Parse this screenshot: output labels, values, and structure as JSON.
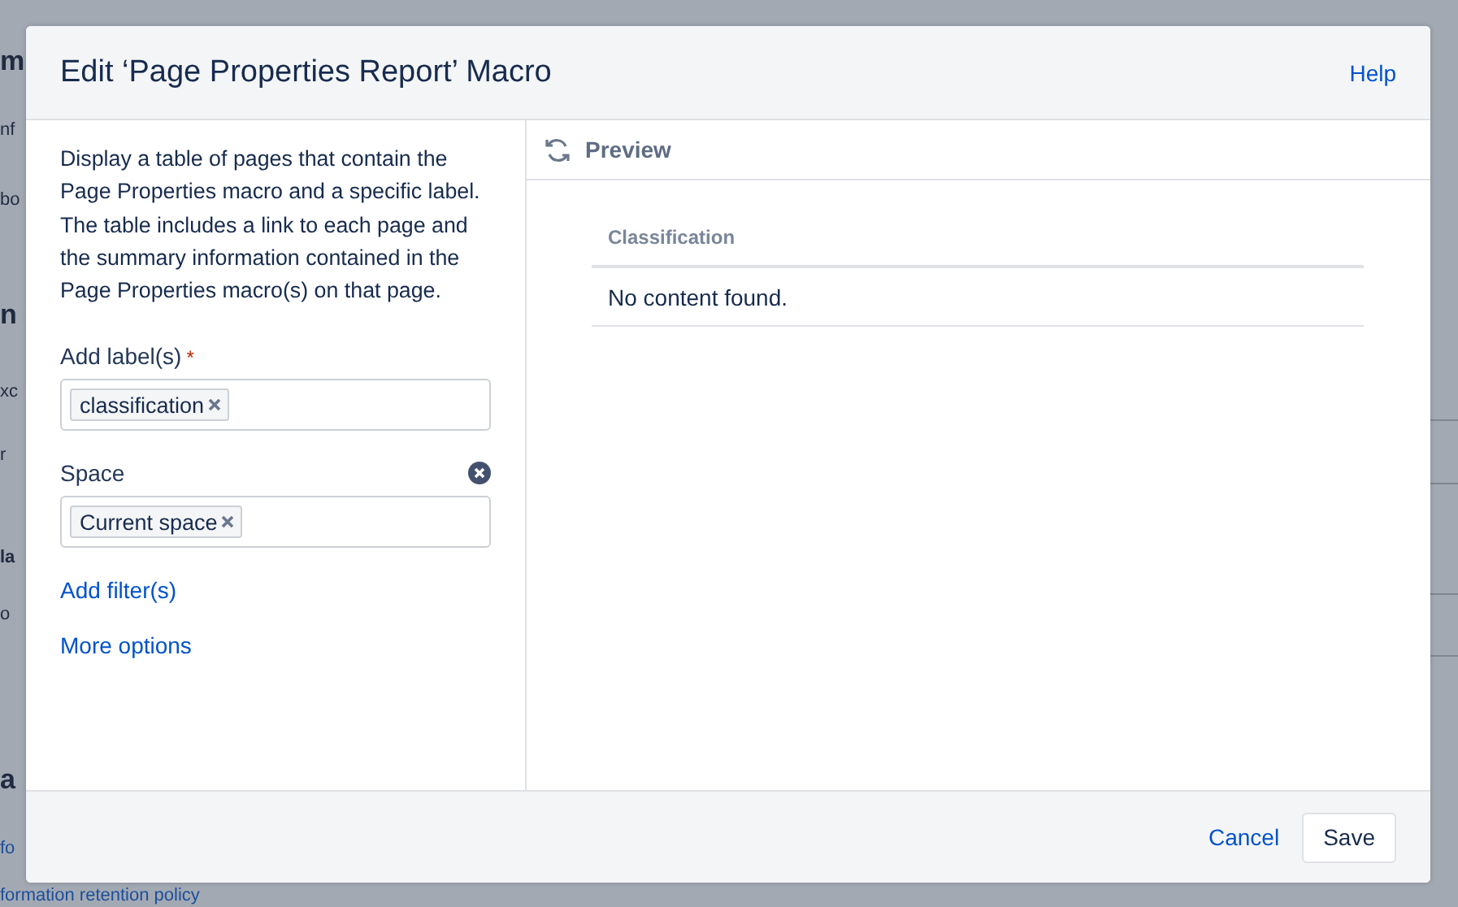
{
  "background": {
    "fragments": [
      {
        "text": "m",
        "kind": "heading"
      },
      {
        "text": "nf",
        "kind": "text"
      },
      {
        "text": "bo",
        "kind": "text"
      },
      {
        "text": "n",
        "kind": "heading"
      },
      {
        "text": "xc",
        "kind": "text"
      },
      {
        "text": "r",
        "kind": "text"
      },
      {
        "text": "la",
        "kind": "bold"
      },
      {
        "text": "o",
        "kind": "text"
      },
      {
        "text": "a",
        "kind": "heading"
      },
      {
        "text": "fo",
        "kind": "link"
      },
      {
        "text": "formation retention policy",
        "kind": "link"
      }
    ]
  },
  "dialog": {
    "title": "Edit ‘Page Properties Report’ Macro",
    "help": "Help",
    "description": "Display a table of pages that contain the Page Properties macro and a specific label. The table includes a link to each page and the summary information contained in the Page Properties macro(s) on that page.",
    "fields": [
      {
        "label": "Add label(s)",
        "marker": "*",
        "clearable": false,
        "tags": [
          "classification"
        ]
      },
      {
        "label": "Space",
        "clearable": true,
        "tags": [
          "Current space"
        ]
      }
    ],
    "links": [
      "Add filter(s)",
      "More options"
    ],
    "preview": {
      "title": "Preview",
      "column": "Classification",
      "empty": "No content found."
    },
    "buttons": [
      {
        "label": "Cancel",
        "kind": "link"
      },
      {
        "label": "Save",
        "kind": "button"
      }
    ]
  }
}
